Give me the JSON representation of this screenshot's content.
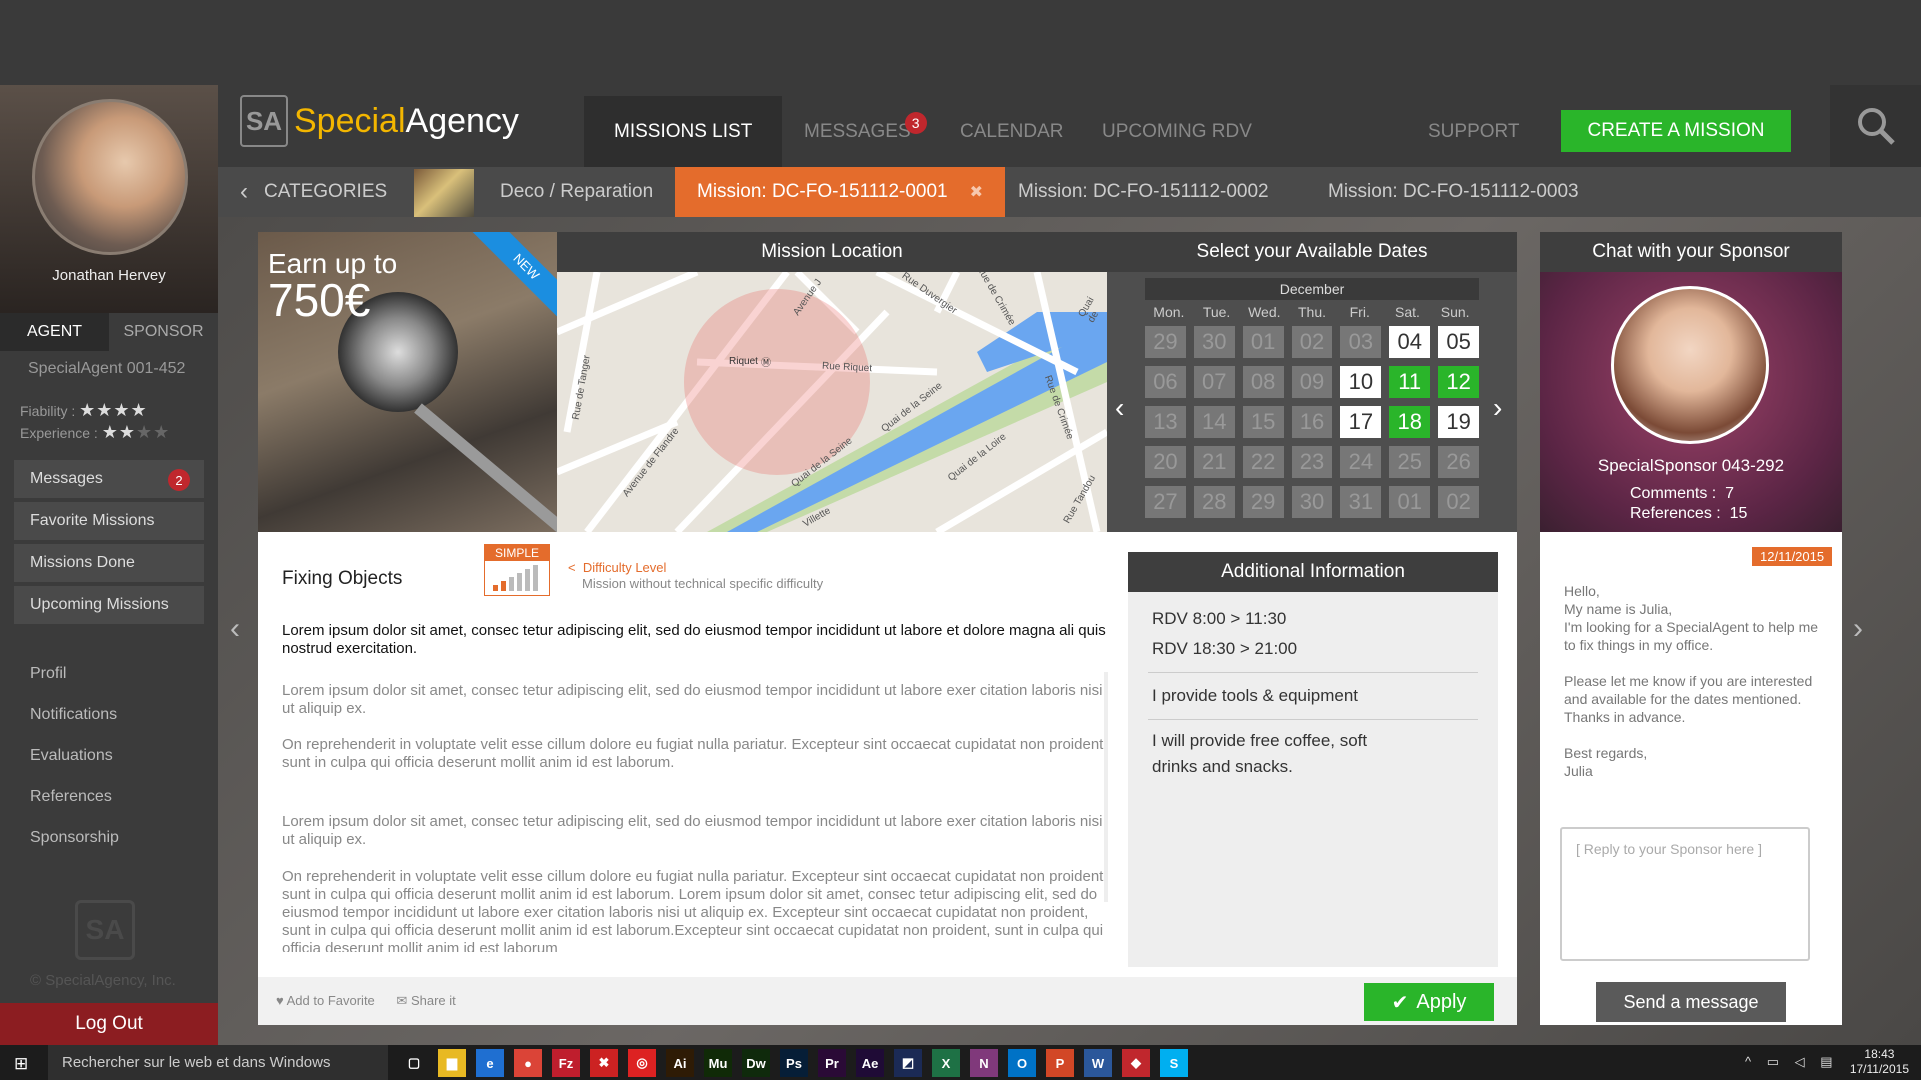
{
  "sidebar": {
    "name": "Jonathan Hervey",
    "tab_agent": "AGENT",
    "tab_sponsor": "SPONSOR",
    "agent_id": "SpecialAgent 001-452",
    "fiability_label": "Fiability :",
    "experience_label": "Experience :",
    "fiability_stars": 4,
    "experience_stars": 2,
    "menu": [
      {
        "label": "Messages",
        "badge": "2"
      },
      {
        "label": "Favorite Missions"
      },
      {
        "label": "Missions Done"
      },
      {
        "label": "Upcoming Missions"
      }
    ],
    "links": [
      "Profil",
      "Notifications",
      "Evaluations",
      "References",
      "Sponsorship"
    ],
    "copyright": "© SpecialAgency, Inc.",
    "logout": "Log Out"
  },
  "header": {
    "logo_a": "Special",
    "logo_b": "Agency",
    "logo_mark": "SA",
    "nav": {
      "missions": "MISSIONS LIST",
      "messages": "MESSAGES",
      "messages_badge": "3",
      "calendar": "CALENDAR",
      "rdv": "UPCOMING RDV",
      "support": "SUPPORT"
    },
    "create": "CREATE A MISSION"
  },
  "breadcrumb": {
    "categories": "CATEGORIES",
    "category": "Deco / Reparation",
    "tabs": [
      "Mission: DC-FO-151112-0001",
      "Mission: DC-FO-151112-0002",
      "Mission: DC-FO-151112-0003"
    ],
    "close": "✖"
  },
  "promo": {
    "earn": "Earn up to",
    "amount": "750€",
    "ribbon": "NEW"
  },
  "map": {
    "title": "Mission Location",
    "streets": [
      "Avenue de Flandre",
      "Rue de Tanger",
      "Riquet",
      "Rue Riquet",
      "Quai de la Seine",
      "Quai de la Seine",
      "Quai de la Loire",
      "Rue Duvergier",
      "Rue de Crimée",
      "Rue de Crimée",
      "Quai de",
      "Rue Tandou",
      "Villette",
      "Avenue J"
    ]
  },
  "calendar": {
    "title": "Select your Available Dates",
    "month": "December",
    "days": [
      "Mon.",
      "Tue.",
      "Wed.",
      "Thu.",
      "Fri.",
      "Sat.",
      "Sun."
    ],
    "weeks": [
      [
        [
          "29",
          ""
        ],
        [
          "30",
          ""
        ],
        [
          "01",
          ""
        ],
        [
          "02",
          ""
        ],
        [
          "03",
          ""
        ],
        [
          "04",
          "av"
        ],
        [
          "05",
          "av"
        ]
      ],
      [
        [
          "06",
          ""
        ],
        [
          "07",
          ""
        ],
        [
          "08",
          ""
        ],
        [
          "09",
          ""
        ],
        [
          "10",
          "av"
        ],
        [
          "11",
          "sel"
        ],
        [
          "12",
          "sel"
        ]
      ],
      [
        [
          "13",
          ""
        ],
        [
          "14",
          ""
        ],
        [
          "15",
          ""
        ],
        [
          "16",
          ""
        ],
        [
          "17",
          "av"
        ],
        [
          "18",
          "sel"
        ],
        [
          "19",
          "av"
        ]
      ],
      [
        [
          "20",
          ""
        ],
        [
          "21",
          ""
        ],
        [
          "22",
          ""
        ],
        [
          "23",
          ""
        ],
        [
          "24",
          ""
        ],
        [
          "25",
          ""
        ],
        [
          "26",
          ""
        ]
      ],
      [
        [
          "27",
          ""
        ],
        [
          "28",
          ""
        ],
        [
          "29",
          ""
        ],
        [
          "30",
          ""
        ],
        [
          "31",
          ""
        ],
        [
          "01",
          ""
        ],
        [
          "02",
          ""
        ]
      ]
    ]
  },
  "mission": {
    "title": "Fixing Objects",
    "level": "SIMPLE",
    "difficulty_title": "Difficulty Level",
    "difficulty_desc": "Mission without technical specific difficulty",
    "lead": "Lorem ipsum dolor sit amet, consec tetur adipiscing elit, sed do eiusmod tempor incididunt ut labore et dolore magna ali quis nostrud exercitation.",
    "p1": "Lorem ipsum dolor sit amet, consec tetur adipiscing elit, sed do eiusmod tempor incididunt ut labore exer citation laboris nisi ut aliquip ex.",
    "p2": "On reprehenderit in voluptate velit esse cillum dolore eu fugiat nulla pariatur. Excepteur sint occaecat cupidatat non proident, sunt in culpa qui officia deserunt mollit anim id est laborum.",
    "p3": "Lorem ipsum dolor sit amet, consec tetur adipiscing elit, sed do eiusmod tempor incididunt ut labore exer citation laboris nisi ut aliquip ex.",
    "p4": "On reprehenderit in voluptate velit esse cillum dolore eu fugiat nulla pariatur. Excepteur sint occaecat cupidatat non proident, sunt in culpa qui officia deserunt mollit anim id est laborum. Lorem ipsum dolor sit amet, consec tetur adipiscing elit, sed do eiusmod tempor incididunt ut labore exer citation laboris nisi ut aliquip ex. Excepteur sint occaecat cupidatat non proident, sunt in culpa qui officia deserunt mollit anim id est laborum.Excepteur sint occaecat cupidatat non proident, sunt in culpa qui officia deserunt mollit anim id est laborum",
    "add_fav": "Add to Favorite",
    "share": "Share it",
    "apply": "Apply"
  },
  "addinfo": {
    "title": "Additional Information",
    "rdv1": "RDV 8:00 > 11:30",
    "rdv2": "RDV 18:30 > 21:00",
    "tools": "I provide tools & equipment",
    "extra": "I will provide free coffee, soft drinks and snacks."
  },
  "chat": {
    "title": "Chat with your Sponsor",
    "sponsor": "SpecialSponsor 043-292",
    "comments_label": "Comments :",
    "comments": "7",
    "refs_label": "References :",
    "refs": "15",
    "date": "12/11/2015",
    "lines": [
      "Hello,",
      "My name is Julia,",
      "I'm looking for a SpecialAgent to help me to fix things in my office.",
      "",
      "Please let me know if you are interested and available for the dates mentioned. Thanks in advance.",
      "",
      "Best regards,",
      "Julia"
    ],
    "reply_placeholder": "[ Reply to your Sponsor here ]",
    "send": "Send a message"
  },
  "taskbar": {
    "search": "Rechercher sur le web et dans Windows",
    "time": "18:43",
    "date": "17/11/2015",
    "apps": [
      {
        "name": "task-view-icon",
        "label": "▢",
        "color": "#1c1c1c"
      },
      {
        "name": "explorer-icon",
        "label": "▆",
        "color": "#e8b923"
      },
      {
        "name": "edge-icon",
        "label": "e",
        "color": "#1f6fd1"
      },
      {
        "name": "chrome-icon",
        "label": "●",
        "color": "#db4437"
      },
      {
        "name": "filezilla-icon",
        "label": "Fz",
        "color": "#bf1e2d"
      },
      {
        "name": "app-x-icon",
        "label": "✖",
        "color": "#cc2222"
      },
      {
        "name": "app-red-icon",
        "label": "◎",
        "color": "#d22"
      },
      {
        "name": "illustrator-icon",
        "label": "Ai",
        "color": "#2e1b05"
      },
      {
        "name": "muse-icon",
        "label": "Mu",
        "color": "#102a07"
      },
      {
        "name": "dreamweaver-icon",
        "label": "Dw",
        "color": "#0f2a0c"
      },
      {
        "name": "photoshop-icon",
        "label": "Ps",
        "color": "#061e37"
      },
      {
        "name": "premiere-icon",
        "label": "Pr",
        "color": "#2a0a36"
      },
      {
        "name": "after-effects-icon",
        "label": "Ae",
        "color": "#1f0b36"
      },
      {
        "name": "app-blue-icon",
        "label": "◩",
        "color": "#1b2a55"
      },
      {
        "name": "excel-icon",
        "label": "X",
        "color": "#1e7145"
      },
      {
        "name": "onenote-icon",
        "label": "N",
        "color": "#80397b"
      },
      {
        "name": "outlook-icon",
        "label": "O",
        "color": "#0072c6"
      },
      {
        "name": "powerpoint-icon",
        "label": "P",
        "color": "#d24726"
      },
      {
        "name": "word-icon",
        "label": "W",
        "color": "#2b579a"
      },
      {
        "name": "app-cube-icon",
        "label": "◆",
        "color": "#c0272d"
      },
      {
        "name": "skype-icon",
        "label": "S",
        "color": "#00aff0"
      }
    ]
  },
  "colors": {
    "orange": "#e46c2c",
    "green": "#2ab52a",
    "dark": "#3e3e3e",
    "red": "#c0272d"
  }
}
